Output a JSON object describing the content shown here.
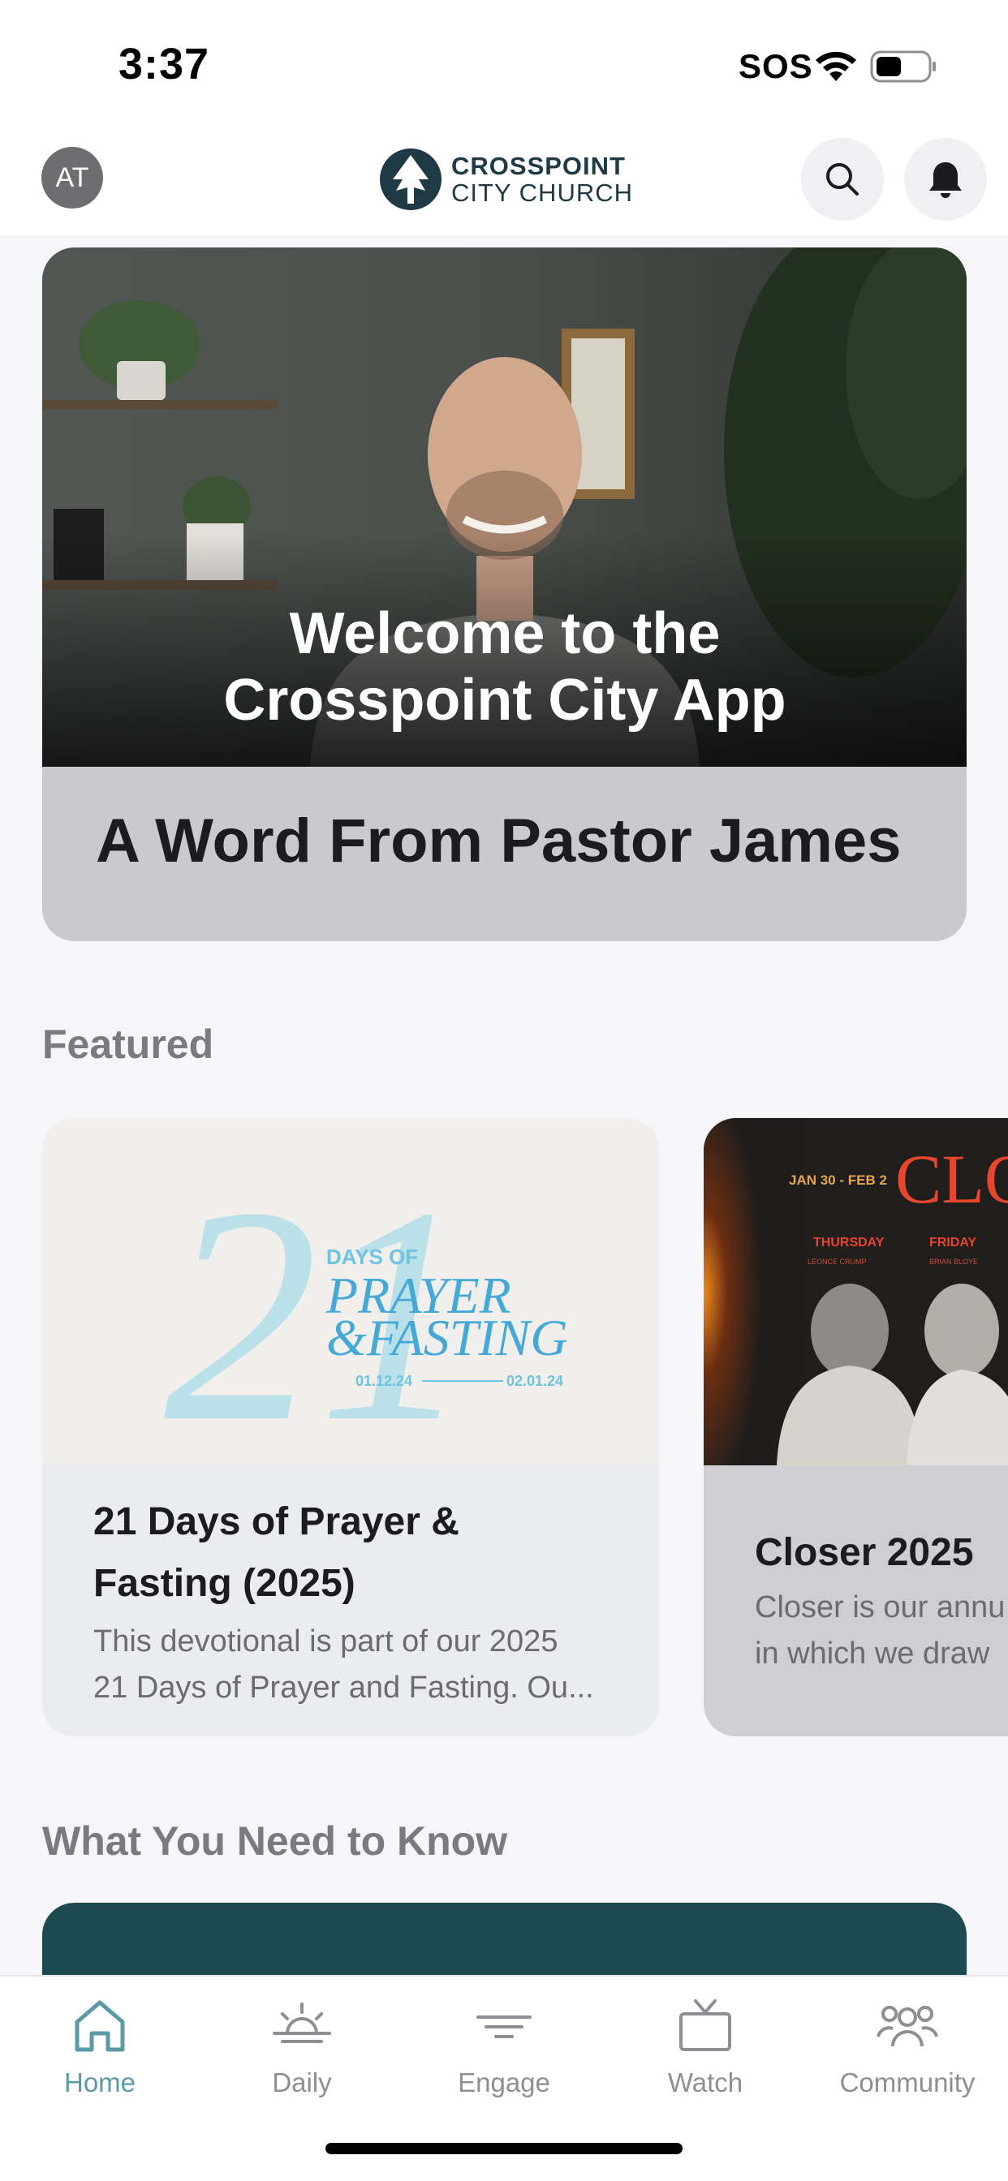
{
  "status_bar": {
    "time": "3:37",
    "carrier": "SOS"
  },
  "header": {
    "avatar_initials": "AT",
    "logo_line1": "CROSSPOINT",
    "logo_line2": "CITY CHURCH"
  },
  "hero": {
    "image_text_line1": "Welcome to the",
    "image_text_line2": "Crosspoint City App",
    "caption": "A Word From Pastor James"
  },
  "featured": {
    "title": "Featured",
    "cards": [
      {
        "graphic_number": "21",
        "graphic_days_of": "DAYS OF",
        "graphic_prayer": "PRAYER",
        "graphic_fasting": "&FASTING",
        "graphic_start": "01.12.24",
        "graphic_end": "02.01.24",
        "title_line1": "21 Days of Prayer &",
        "title_line2": "Fasting (2025)",
        "desc_line1": "This devotional is part of our 2025",
        "desc_line2": "21 Days of Prayer and Fasting. Ou..."
      },
      {
        "graphic_dates": "JAN 30 - FEB 2",
        "graphic_word": "CLO",
        "graphic_day1": "THURSDAY",
        "graphic_day2": "FRIDAY",
        "graphic_name1": "LEONCE CRUMP",
        "graphic_name2": "BRIAN BLOYE",
        "title": "Closer 2025",
        "desc_line1": "Closer is our annu",
        "desc_line2": "in which we draw"
      }
    ]
  },
  "know": {
    "title": "What You Need to Know"
  },
  "tabs": [
    {
      "label": "Home",
      "icon": "home-icon",
      "active": true
    },
    {
      "label": "Daily",
      "icon": "sunrise-icon",
      "active": false
    },
    {
      "label": "Engage",
      "icon": "filter-icon",
      "active": false
    },
    {
      "label": "Watch",
      "icon": "tv-icon",
      "active": false
    },
    {
      "label": "Community",
      "icon": "people-icon",
      "active": false
    }
  ],
  "colors": {
    "accent": "#5b9aa6",
    "brand": "#1e3a44",
    "inactive": "#8e8e93"
  }
}
